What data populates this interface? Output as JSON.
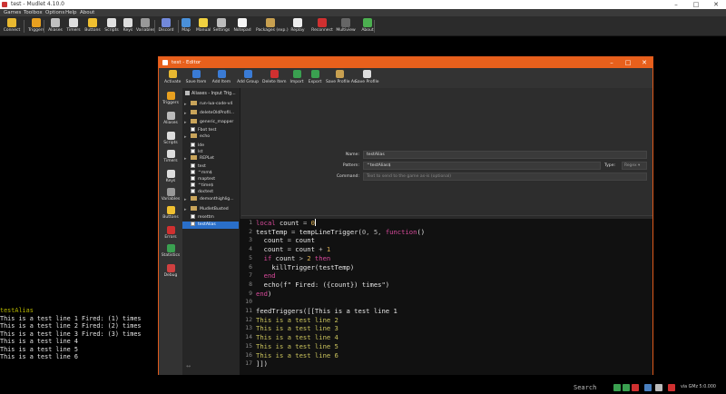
{
  "window": {
    "title": "test - Mudlet 4.10.0"
  },
  "menu": [
    "Games",
    "Toolbox",
    "Options",
    "Help",
    "About"
  ],
  "toolbar": [
    {
      "label": "Connect",
      "icon": "connect-icon",
      "color": "#e8b830"
    },
    {
      "label": "Triggers",
      "icon": "trigger-icon",
      "color": "#e8a020"
    },
    {
      "label": "Aliases",
      "icon": "alias-icon",
      "color": "#c0c0c0"
    },
    {
      "label": "Timers",
      "icon": "timer-icon",
      "color": "#dddddd"
    },
    {
      "label": "Buttons",
      "icon": "star-icon",
      "color": "#f0c030"
    },
    {
      "label": "Scripts",
      "icon": "script-icon",
      "color": "#e0e0e0"
    },
    {
      "label": "Keys",
      "icon": "keyboard-icon",
      "color": "#dddddd"
    },
    {
      "label": "Variables",
      "icon": "variables-icon",
      "color": "#999999"
    },
    {
      "label": "Discord",
      "icon": "discord-icon",
      "color": "#7289da"
    },
    {
      "label": "Map",
      "icon": "map-icon",
      "color": "#4a90d9"
    },
    {
      "label": "Manual",
      "icon": "lightbulb-icon",
      "color": "#f0d040"
    },
    {
      "label": "Settings",
      "icon": "wrench-icon",
      "color": "#bbbbbb"
    },
    {
      "label": "Notepad",
      "icon": "notepad-icon",
      "color": "#f5f5f5"
    },
    {
      "label": "Packages (exp.)",
      "icon": "package-icon",
      "color": "#c8a050"
    },
    {
      "label": "Replay",
      "icon": "replay-icon",
      "color": "#eeeeee"
    },
    {
      "label": "Reconnect",
      "icon": "reconnect-icon",
      "color": "#d03030"
    },
    {
      "label": "Multiview",
      "icon": "multiview-icon",
      "color": "#666666"
    },
    {
      "label": "About",
      "icon": "about-icon",
      "color": "#4caf50"
    }
  ],
  "console": {
    "lines": [
      "testAlias",
      "This is a test line 1 Fired: (1) times",
      "This is a test line 2 Fired: (2) times",
      "This is a test line 3 Fired: (3) times",
      "This is a test line 4",
      "This is a test line 5",
      "This is a test line 6"
    ]
  },
  "editor": {
    "title": "test - Editor",
    "accent": "#e8601c",
    "toolbar": [
      {
        "label": "Activate",
        "icon": "activate-icon",
        "color": "#e8b830"
      },
      {
        "label": "Save Item",
        "icon": "save-item-icon",
        "color": "#3a7bd5"
      },
      {
        "label": "Add Item",
        "icon": "add-item-icon",
        "color": "#3a7bd5"
      },
      {
        "label": "Add Group",
        "icon": "add-group-icon",
        "color": "#3a7bd5"
      },
      {
        "label": "Delete Item",
        "icon": "delete-icon",
        "color": "#d03030"
      },
      {
        "label": "Import",
        "icon": "import-icon",
        "color": "#3aa050"
      },
      {
        "label": "Export",
        "icon": "export-icon",
        "color": "#3aa050"
      },
      {
        "label": "Save Profile As",
        "icon": "save-profile-as-icon",
        "color": "#c8a050"
      },
      {
        "label": "Save Profile",
        "icon": "save-profile-icon",
        "color": "#dddddd"
      }
    ],
    "sidebar": [
      {
        "label": "Triggers",
        "icon": "trigger-icon",
        "color": "#e8a020"
      },
      {
        "label": "Aliases",
        "icon": "alias-icon",
        "color": "#bbbbbb"
      },
      {
        "label": "Scripts",
        "icon": "script-icon",
        "color": "#dddddd"
      },
      {
        "label": "Timers",
        "icon": "timer-icon",
        "color": "#dddddd"
      },
      {
        "label": "Keys",
        "icon": "keyboard-icon",
        "color": "#dddddd"
      },
      {
        "label": "Variables",
        "icon": "variables-icon",
        "color": "#999999"
      },
      {
        "label": "Buttons",
        "icon": "star-icon",
        "color": "#f0c030"
      },
      {
        "label": "Errors",
        "icon": "error-icon",
        "color": "#d03030"
      },
      {
        "label": "Statistics",
        "icon": "statistics-icon",
        "color": "#3aa050"
      },
      {
        "label": "Debug",
        "icon": "debug-icon",
        "color": "#d04040"
      }
    ],
    "tree": {
      "header": "Aliases - Input Trig...",
      "items": [
        {
          "label": "run-lua-code-v4",
          "kind": "folder",
          "arrow": true
        },
        {
          "label": "deleteOldProfil...",
          "kind": "folder",
          "arrow": true
        },
        {
          "label": "generic_mapper",
          "kind": "folder",
          "arrow": true
        },
        {
          "label": "Fbot test",
          "kind": "item",
          "arrow": false
        },
        {
          "label": "echo",
          "kind": "folder",
          "arrow": true
        },
        {
          "label": "lde",
          "kind": "item",
          "arrow": false
        },
        {
          "label": "lst",
          "kind": "item",
          "arrow": false
        },
        {
          "label": "REPLet",
          "kind": "folder",
          "arrow": true
        },
        {
          "label": "test",
          "kind": "item",
          "arrow": false
        },
        {
          "label": "^mm$",
          "kind": "item",
          "arrow": false
        },
        {
          "label": "maptest",
          "kind": "item",
          "arrow": false
        },
        {
          "label": "^time$",
          "kind": "item",
          "arrow": false
        },
        {
          "label": "doctest",
          "kind": "item",
          "arrow": false
        },
        {
          "label": "demonthighlig...",
          "kind": "folder",
          "arrow": true
        },
        {
          "label": "MudletBusted",
          "kind": "folder",
          "arrow": true
        },
        {
          "label": "resettm",
          "kind": "item",
          "arrow": false
        },
        {
          "label": "testAlias",
          "kind": "item",
          "arrow": false,
          "selected": true
        }
      ]
    },
    "props": {
      "name_label": "Name:",
      "name_value": "testAlias",
      "pattern_label": "Pattern:",
      "pattern_value": "^testAlias$",
      "type_label": "Type:",
      "type_value": "Regex",
      "command_label": "Command:",
      "command_placeholder": "Text to send to the game as-is (optional)"
    },
    "code": {
      "line_numbers": [
        "1",
        "2",
        "3",
        "4",
        "5",
        "6",
        "7",
        "8",
        "9",
        "10",
        "11",
        "12",
        "13",
        "14",
        "15",
        "16",
        "17"
      ]
    }
  },
  "status": {
    "search_placeholder": "Search ...",
    "version": "via GMz 5:0.000"
  }
}
